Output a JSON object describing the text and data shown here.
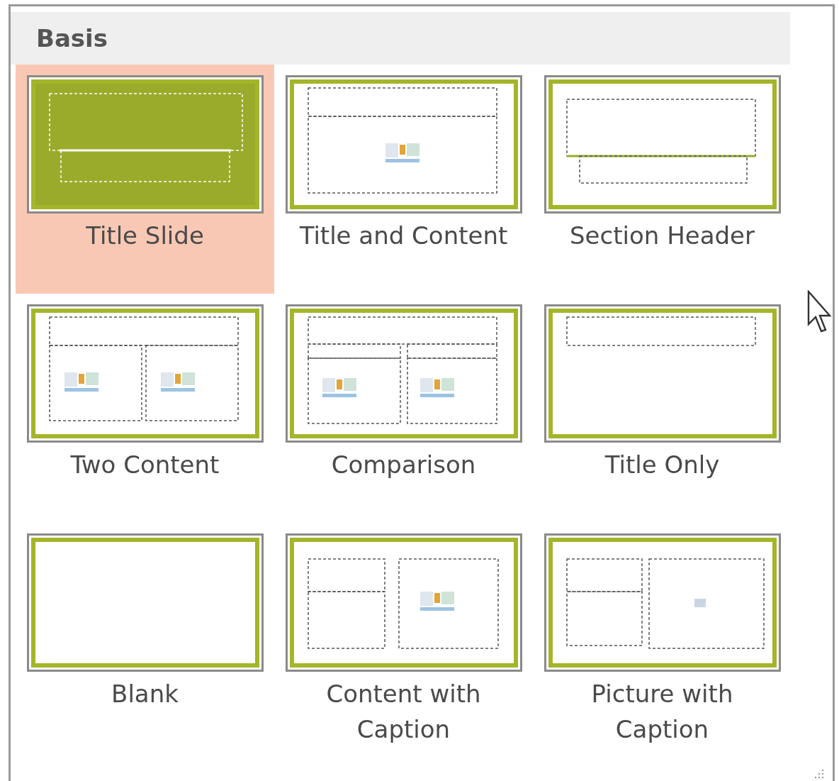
{
  "section": {
    "title": "Basis"
  },
  "layouts": [
    {
      "label": "Title Slide",
      "kind": "title-slide",
      "selected": true
    },
    {
      "label": "Title and Content",
      "kind": "title-content",
      "selected": false
    },
    {
      "label": "Section Header",
      "kind": "section-header",
      "selected": false
    },
    {
      "label": "Two Content",
      "kind": "two-content",
      "selected": false
    },
    {
      "label": "Comparison",
      "kind": "comparison",
      "selected": false
    },
    {
      "label": "Title Only",
      "kind": "title-only",
      "selected": false
    },
    {
      "label": "Blank",
      "kind": "blank",
      "selected": false
    },
    {
      "label": "Content with Caption",
      "kind": "content-caption",
      "selected": false
    },
    {
      "label": "Picture with Caption",
      "kind": "picture-caption",
      "selected": false
    }
  ]
}
